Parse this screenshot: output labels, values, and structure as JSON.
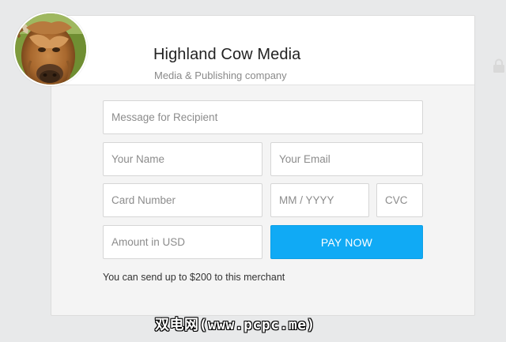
{
  "merchant": {
    "name": "Highland Cow Media",
    "type": "Media & Publishing company",
    "avatar_icon": "highland-cow-photo"
  },
  "form": {
    "message_placeholder": "Message for Recipient",
    "name_placeholder": "Your Name",
    "email_placeholder": "Your Email",
    "card_number_placeholder": "Card Number",
    "expiry_placeholder": "MM / YYYY",
    "cvc_placeholder": "CVC",
    "amount_placeholder": "Amount in USD",
    "pay_label": "PAY NOW",
    "limit_note": "You can send up to $200 to this merchant"
  },
  "colors": {
    "accent": "#10aaf5",
    "page_background": "#e8e9ea",
    "card_background": "#f4f4f4"
  },
  "watermark": "双电网(www.pcpc.me)"
}
